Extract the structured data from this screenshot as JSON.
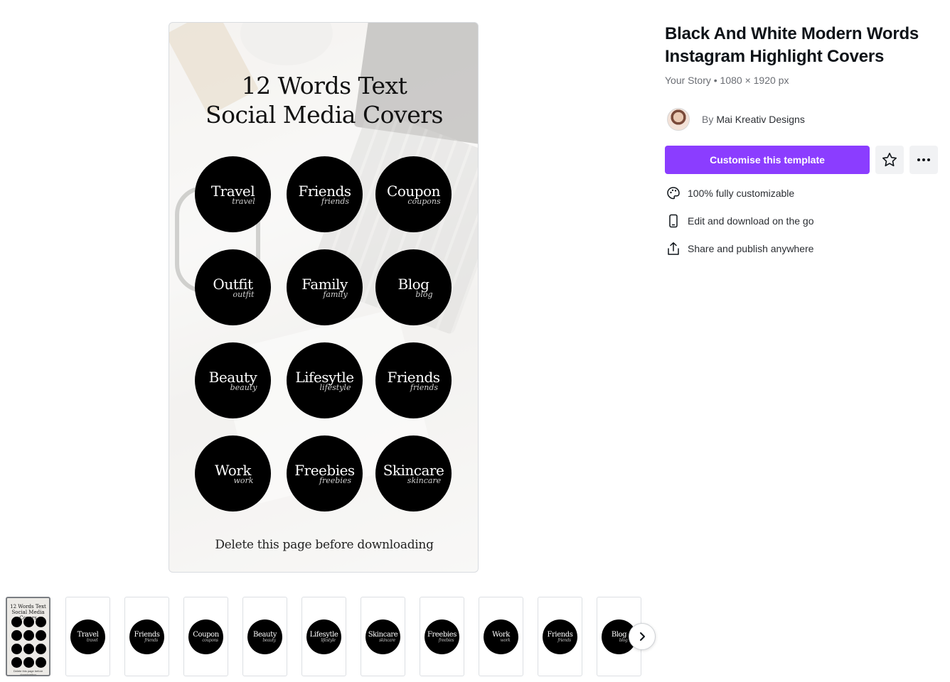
{
  "preview": {
    "title": "12 Words Text\nSocial Media Covers",
    "covers": [
      {
        "main": "Travel",
        "script": "travel"
      },
      {
        "main": "Friends",
        "script": "friends"
      },
      {
        "main": "Coupon",
        "script": "coupons"
      },
      {
        "main": "Outfit",
        "script": "outfit"
      },
      {
        "main": "Family",
        "script": "family"
      },
      {
        "main": "Blog",
        "script": "blog"
      },
      {
        "main": "Beauty",
        "script": "beauty"
      },
      {
        "main": "Lifesytle",
        "script": "lifestyle"
      },
      {
        "main": "Friends",
        "script": "friends"
      },
      {
        "main": "Work",
        "script": "work"
      },
      {
        "main": "Freebies",
        "script": "freebies"
      },
      {
        "main": "Skincare",
        "script": "skincare"
      }
    ],
    "note": "Delete this page before downloading"
  },
  "thumbnails": {
    "first": {
      "title": "12 Words Text\nSocial Media Covers",
      "note": "Delete this page before downloading"
    },
    "items": [
      {
        "main": "Travel",
        "script": "travel"
      },
      {
        "main": "Friends",
        "script": "friends"
      },
      {
        "main": "Coupon",
        "script": "coupons"
      },
      {
        "main": "Beauty",
        "script": "beauty"
      },
      {
        "main": "Lifesytle",
        "script": "lifestyle"
      },
      {
        "main": "Skincare",
        "script": "skincare"
      },
      {
        "main": "Freebies",
        "script": "freebies"
      },
      {
        "main": "Work",
        "script": "work"
      },
      {
        "main": "Friends",
        "script": "friends"
      },
      {
        "main": "Blog",
        "script": "blog"
      }
    ],
    "next_icon": "chevron-right-icon"
  },
  "details": {
    "title": "Black And White Modern Words\nInstagram Highlight Covers",
    "meta": "Your Story • 1080 × 1920 px",
    "author_prefix": "By",
    "author_name": "Mai Kreativ Designs",
    "cta_label": "Customise this template",
    "cta_color": "#8b3dff",
    "favorite_icon": "star-icon",
    "more_icon": "more-horizontal-icon",
    "features": [
      {
        "icon": "palette-icon",
        "text": "100% fully customizable"
      },
      {
        "icon": "phone-icon",
        "text": "Edit and download on the go"
      },
      {
        "icon": "share-icon",
        "text": "Share and publish anywhere"
      }
    ]
  }
}
